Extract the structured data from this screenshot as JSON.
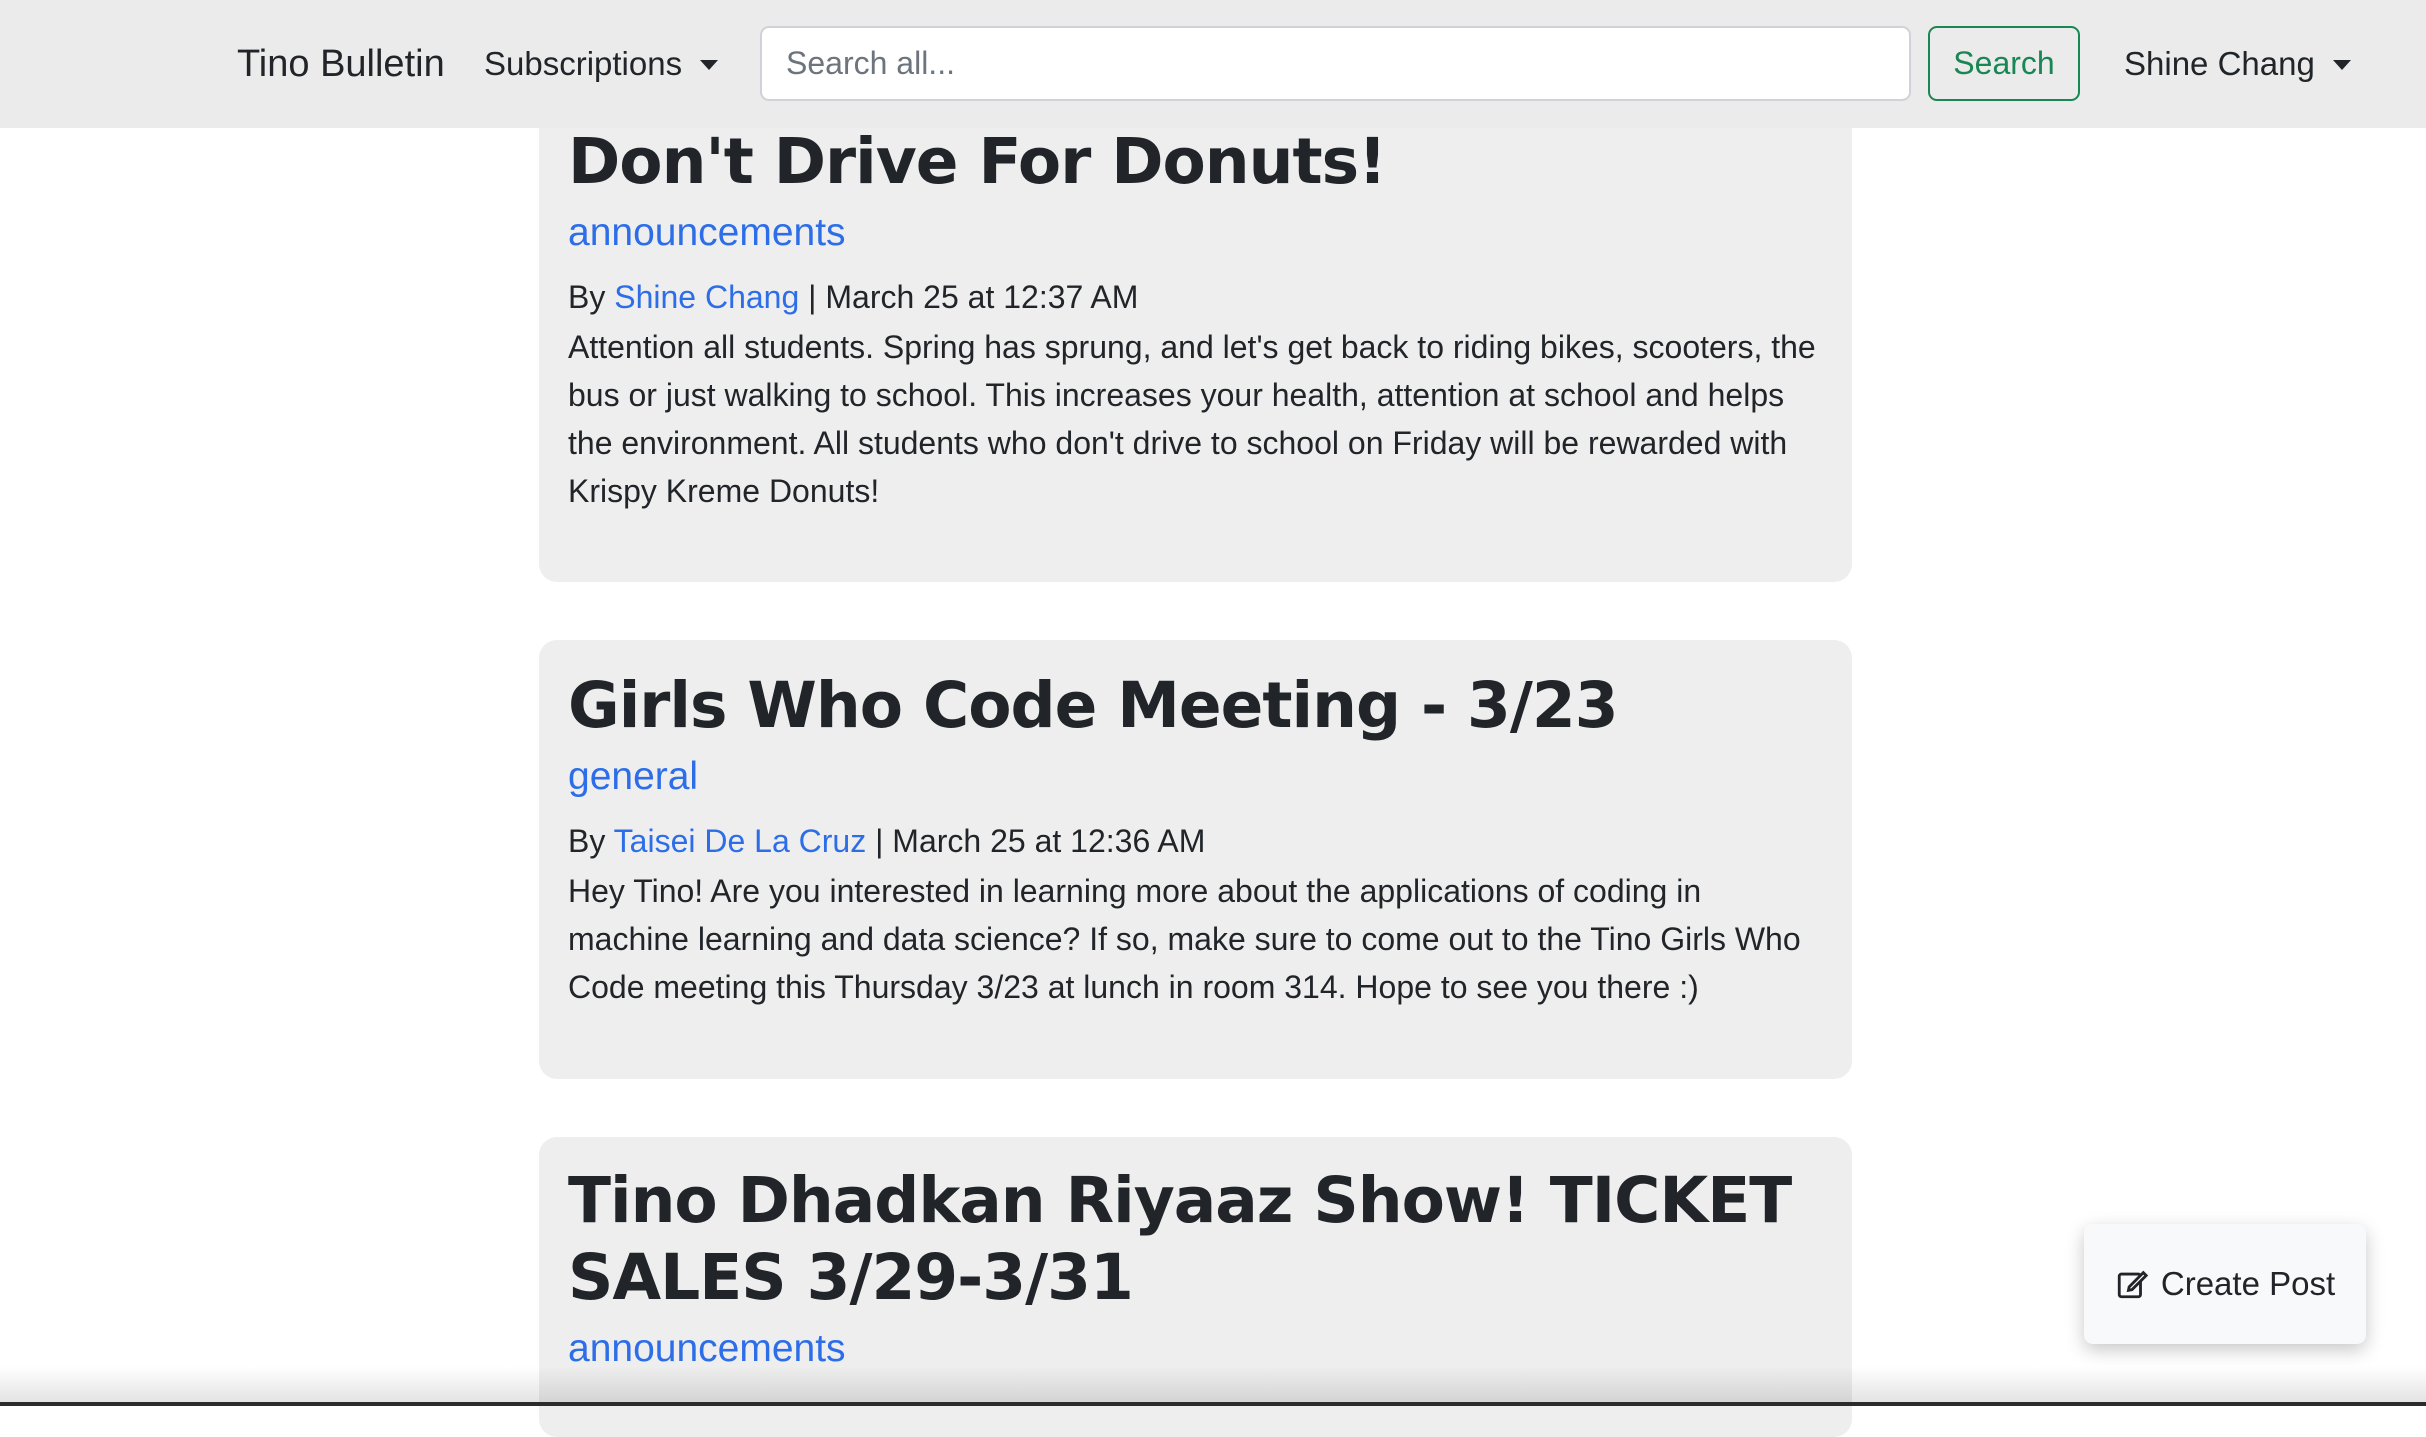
{
  "navbar": {
    "brand": "Tino Bulletin",
    "subscriptions_label": "Subscriptions",
    "search_placeholder": "Search all...",
    "search_button": "Search",
    "user_name": "Shine Chang"
  },
  "posts": [
    {
      "title": "Don't Drive For Donuts!",
      "category": "announcements",
      "by_label": "By",
      "author": "Shine Chang",
      "date": "| March 25 at 12:37 AM",
      "body": "Attention all students. Spring has sprung, and let's get back to riding bikes, scooters, the bus or just walking to school. This increases your health, attention at school and helps the environment. All students who don't drive to school on Friday will be rewarded with Krispy Kreme Donuts!"
    },
    {
      "title": "Girls Who Code Meeting - 3/23",
      "category": "general",
      "by_label": "By",
      "author": "Taisei De La Cruz",
      "date": "| March 25 at 12:36 AM",
      "body": "Hey Tino! Are you interested in learning more about the applications of coding in machine learning and data science? If so, make sure to come out to the Tino Girls Who Code meeting this Thursday 3/23 at lunch in room 314. Hope to see you there :)"
    },
    {
      "title": "Tino Dhadkan Riyaaz Show! TICKET SALES 3/29-3/31",
      "category": "announcements"
    }
  ],
  "create_post": {
    "label": "Create Post",
    "icon": "edit-icon"
  }
}
